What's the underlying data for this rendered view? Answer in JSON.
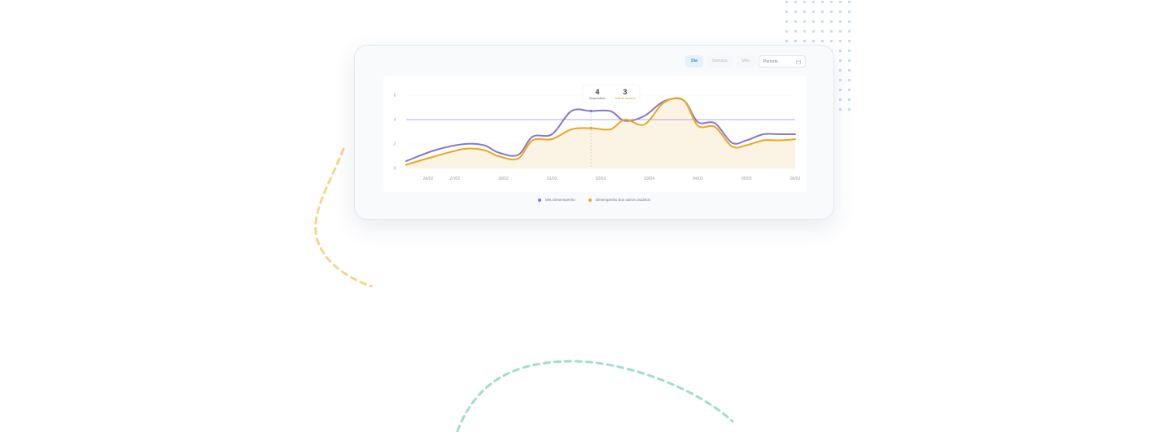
{
  "toolbar": {
    "tabs": [
      {
        "label": "Dia",
        "active": true
      },
      {
        "label": "Semana",
        "active": false
      },
      {
        "label": "Mês",
        "active": false
      }
    ],
    "period_label": "Período",
    "calendar_icon": "calendar-icon"
  },
  "tooltip": {
    "primary_value": "4",
    "primary_label": "Respondidos",
    "secondary_value": "3",
    "secondary_label": "Total de usuários"
  },
  "chart_data": {
    "type": "line",
    "categories": [
      "26/02",
      "27/02",
      "28/02",
      "01/03",
      "02/03",
      "03/04",
      "04/03",
      "05/03",
      "06/03"
    ],
    "y_ticks": [
      "0",
      "2",
      "4",
      "6"
    ],
    "ylim": [
      0,
      6
    ],
    "x": [
      0,
      0.6,
      1.2,
      1.6,
      1.9,
      2.3,
      2.6,
      3.0,
      3.4,
      3.8,
      4.2,
      4.5,
      4.9,
      5.3,
      5.7,
      6.0,
      6.35,
      6.7,
      7.0,
      7.35,
      7.7,
      8.0
    ],
    "series": [
      {
        "name": "Meu Desempenho",
        "color": "#8a77c9",
        "values": [
          0.6,
          1.5,
          2.0,
          1.9,
          1.3,
          1.1,
          2.6,
          2.8,
          4.7,
          4.7,
          4.7,
          3.9,
          4.3,
          5.5,
          5.6,
          3.8,
          3.7,
          2.1,
          2.3,
          2.8,
          2.8,
          2.8
        ]
      },
      {
        "name": "Desempenho dos outros usuários",
        "color": "#eba71f",
        "values": [
          0.3,
          1.0,
          1.6,
          1.5,
          1.0,
          0.8,
          2.3,
          2.4,
          3.2,
          3.3,
          3.2,
          4.0,
          3.6,
          5.4,
          5.6,
          3.5,
          3.4,
          1.8,
          1.9,
          2.3,
          2.3,
          2.4
        ]
      }
    ],
    "reference_line": 4,
    "hover_index": 9,
    "fill_color": "#fbf3e4",
    "grid": true,
    "legend_position": "bottom"
  }
}
